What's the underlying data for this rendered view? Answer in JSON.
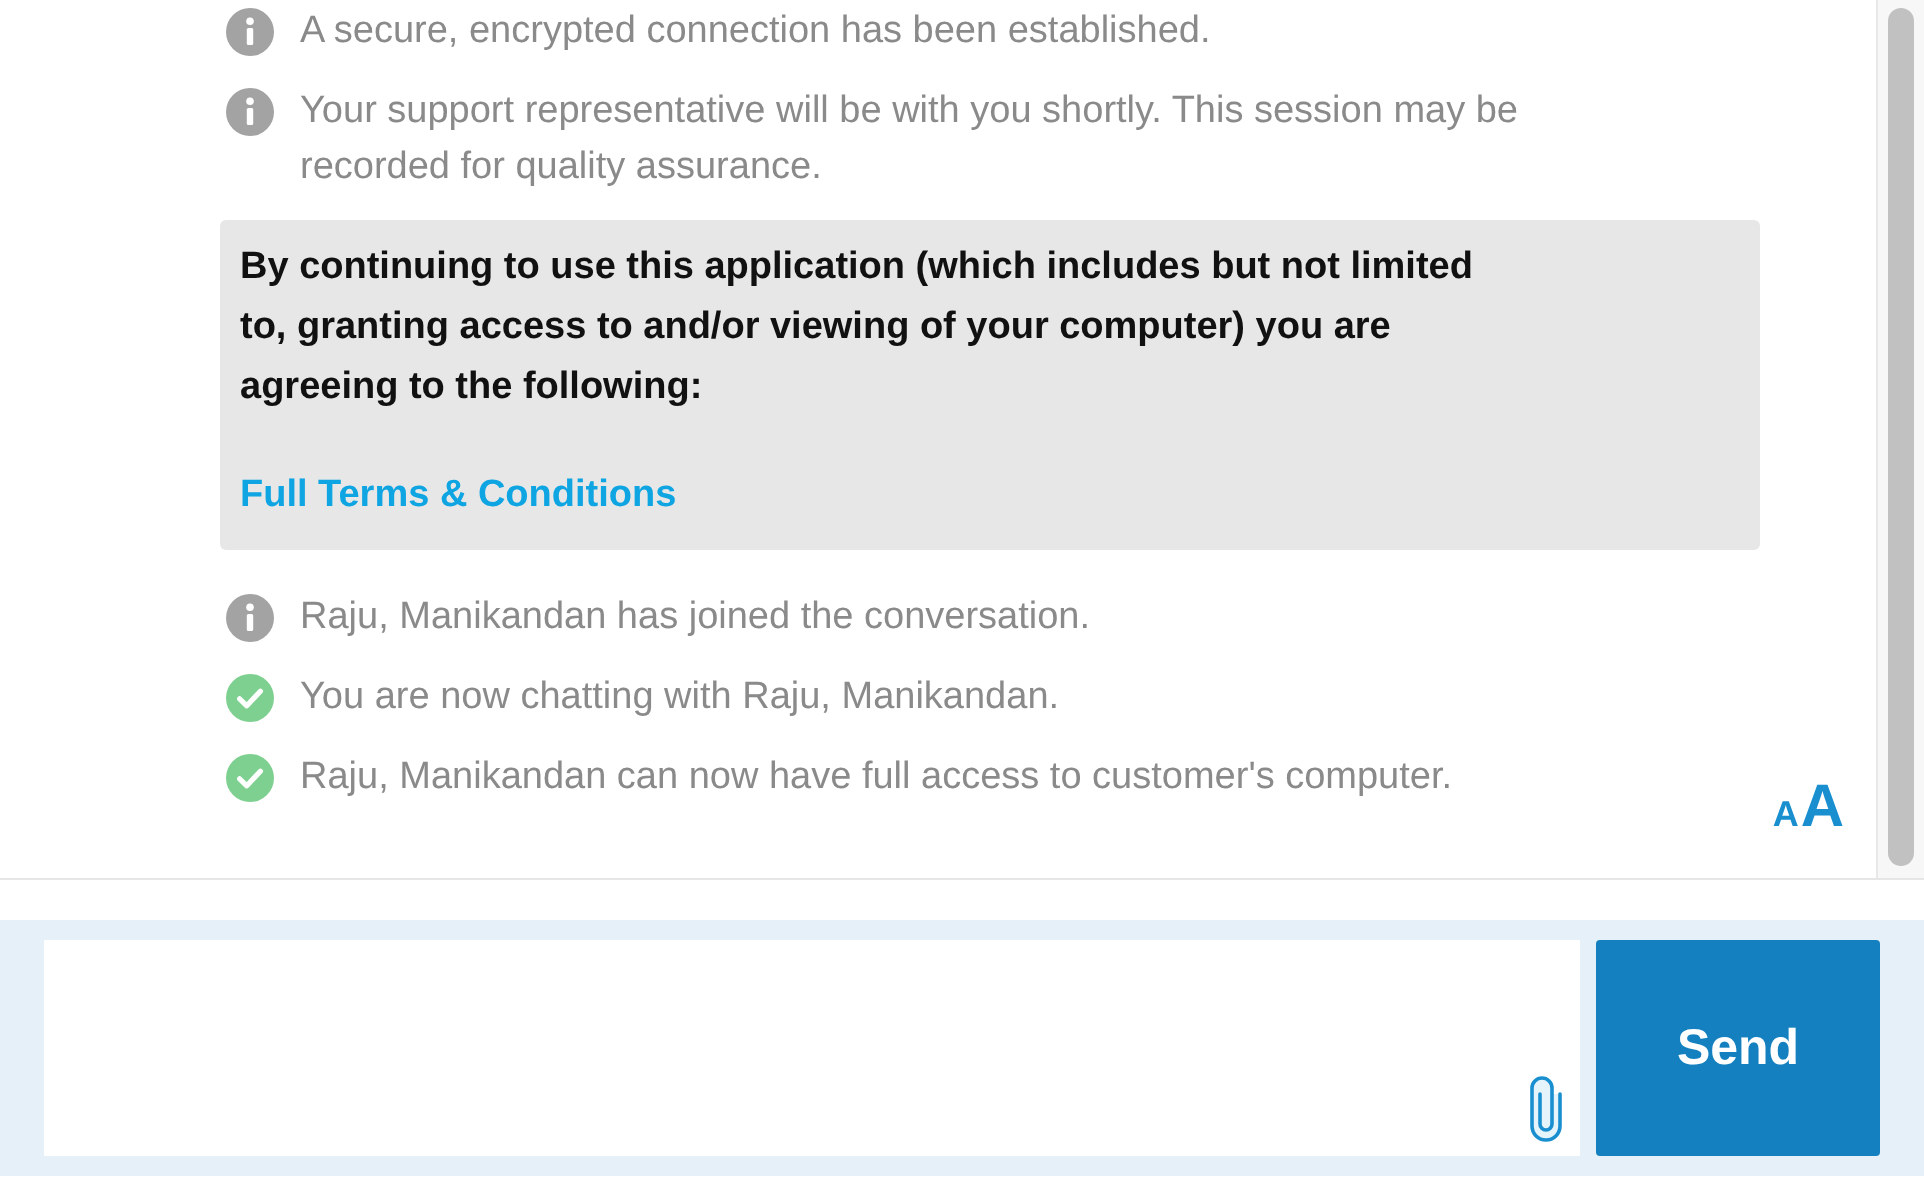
{
  "messages": [
    {
      "kind": "info",
      "text": "A secure, encrypted connection has been established."
    },
    {
      "kind": "info",
      "text": "Your support representative will be with you shortly. This session may be recorded for quality assurance."
    },
    {
      "kind": "notice",
      "text": "By continuing to use this application (which includes but not limited to, granting access to and/or viewing of your computer) you are agreeing to the following:",
      "link": "Full Terms & Conditions"
    },
    {
      "kind": "info",
      "text": "Raju, Manikandan has joined the conversation."
    },
    {
      "kind": "success",
      "text": "You are now chatting with Raju, Manikandan."
    },
    {
      "kind": "success",
      "text": "Raju, Manikandan can now have full access to customer's computer."
    }
  ],
  "font_size_control": {
    "small": "A",
    "large": "A"
  },
  "composer": {
    "send_button": "Send"
  }
}
